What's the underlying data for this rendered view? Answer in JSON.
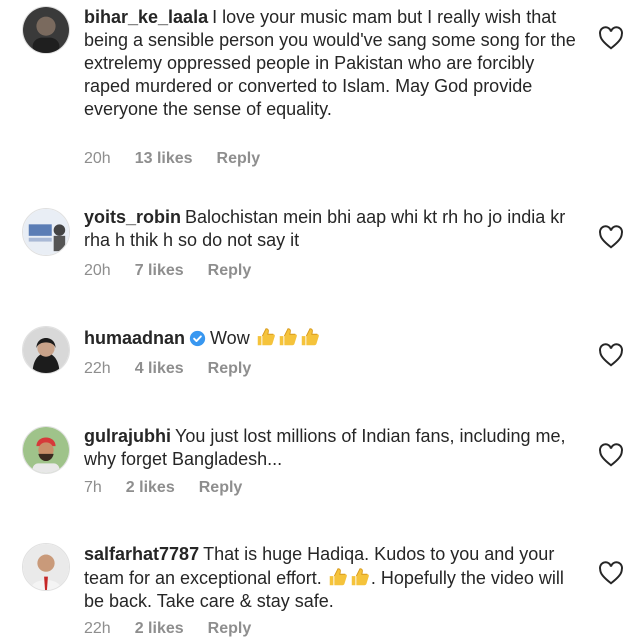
{
  "comments": [
    {
      "username": "bihar_ke_laala",
      "text": "I love your music mam but I really wish that being a sensible person you would've sang some song for the extrelemy oppressed people in Pakistan who are forcibly raped murdered or converted to Islam. May God provide everyone the sense of equality.",
      "time": "20h",
      "likes": "13 likes",
      "reply": "Reply"
    },
    {
      "username": "yoits_robin",
      "text": "Balochistan mein bhi aap whi kt rh ho jo india kr rha h thik h so do not say it",
      "time": "20h",
      "likes": "7 likes",
      "reply": "Reply"
    },
    {
      "username": "humaadnan",
      "text": "Wow",
      "time": "22h",
      "likes": "4 likes",
      "reply": "Reply",
      "verified": true,
      "emoji": "thumbs-up x3"
    },
    {
      "username": "gulrajubhi",
      "text": "You just lost millions of Indian fans, including me, why forget Bangladesh...",
      "time": "7h",
      "likes": "2 likes",
      "reply": "Reply"
    },
    {
      "username": "salfarhat7787",
      "text_before": "That is huge Hadiqa. Kudos to you and your team for an exceptional effort.",
      "text_after": ". Hopefully the video will be back. Take care & stay safe.",
      "time": "22h",
      "likes": "2 likes",
      "reply": "Reply",
      "emoji": "thumbs-up x2"
    }
  ],
  "colors": {
    "text": "#262626",
    "meta": "#8e8e8e",
    "verified": "#3897f0",
    "emoji": "#f5c33b"
  },
  "icons": {
    "like": "heart-outline-icon",
    "verified": "verified-badge-icon",
    "emoji": "thumbs-up-emoji-icon"
  }
}
